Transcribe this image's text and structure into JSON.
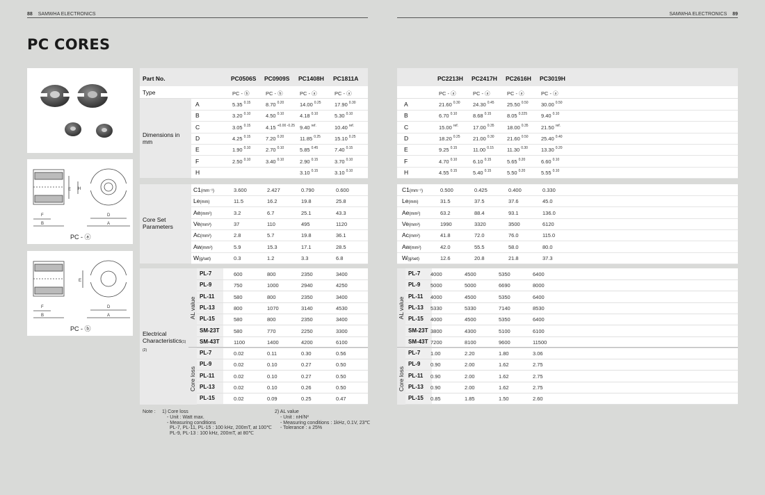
{
  "header": {
    "left_page": "88",
    "left_brand": "SAMWHA ELECTRONICS",
    "right_brand": "SAMWHA ELECTRONICS",
    "right_page": "89"
  },
  "title": "PC CORES",
  "captions": {
    "fig_a": "PC - ⓐ",
    "fig_b": "PC - ⓑ"
  },
  "diagram_labels": {
    "A": "A",
    "B": "B",
    "D": "D",
    "E": "E",
    "F": "F",
    "H": "H"
  },
  "left_table": {
    "part_label": "Part No.",
    "type_label": "Type",
    "parts": [
      "PC0506S",
      "PC0909S",
      "PC1408H",
      "PC1811A"
    ],
    "types": [
      "PC - ⓑ",
      "PC - ⓑ",
      "PC - ⓐ",
      "PC - ⓐ"
    ],
    "dim_group": "Dimensions in mm",
    "dim_rows": [
      {
        "k": "A",
        "v": [
          [
            "5.35",
            "0.15"
          ],
          [
            "8.70",
            "0.20"
          ],
          [
            "14.00",
            "0.25"
          ],
          [
            "17.90",
            "0.30"
          ]
        ]
      },
      {
        "k": "B",
        "v": [
          [
            "3.20",
            "0.10"
          ],
          [
            "4.50",
            "0.10"
          ],
          [
            "4.18",
            "0.10"
          ],
          [
            "5.30",
            "0.10"
          ]
        ]
      },
      {
        "k": "C",
        "v": [
          [
            "3.05",
            "0.15"
          ],
          [
            "4.15",
            "+0.00 -0.25"
          ],
          [
            "9.40",
            "ref."
          ],
          [
            "10.40",
            "ref."
          ]
        ]
      },
      {
        "k": "D",
        "v": [
          [
            "4.25",
            "0.15"
          ],
          [
            "7.20",
            "0.20"
          ],
          [
            "11.85",
            "0.25"
          ],
          [
            "15.10",
            "0.25"
          ]
        ]
      },
      {
        "k": "E",
        "v": [
          [
            "1.90",
            "0.10"
          ],
          [
            "2.70",
            "0.10"
          ],
          [
            "5.85",
            "0.45"
          ],
          [
            "7.40",
            "0.15"
          ]
        ]
      },
      {
        "k": "F",
        "v": [
          [
            "2.50",
            "0.10"
          ],
          [
            "3.40",
            "0.10"
          ],
          [
            "2.90",
            "0.15"
          ],
          [
            "3.70",
            "0.10"
          ]
        ]
      },
      {
        "k": "H",
        "v": [
          [
            "",
            ""
          ],
          [
            "",
            ""
          ],
          [
            "3.10",
            "0.15"
          ],
          [
            "3.10",
            "0.10"
          ]
        ]
      }
    ],
    "core_group": "Core Set Parameters",
    "core_rows": [
      {
        "k": "C1",
        "u": "(mm⁻¹)",
        "v": [
          "3.600",
          "2.427",
          "0.790",
          "0.600"
        ]
      },
      {
        "k": "Le",
        "u": "(mm)",
        "v": [
          "11.5",
          "16.2",
          "19.8",
          "25.8"
        ]
      },
      {
        "k": "Ae",
        "u": "(mm²)",
        "v": [
          "3.2",
          "6.7",
          "25.1",
          "43.3"
        ]
      },
      {
        "k": "Ve",
        "u": "(mm³)",
        "v": [
          "37",
          "110",
          "495",
          "1120"
        ]
      },
      {
        "k": "Ac",
        "u": "(mm²)",
        "v": [
          "2.8",
          "5.7",
          "19.8",
          "36.1"
        ]
      },
      {
        "k": "Aw",
        "u": "(mm²)",
        "v": [
          "5.9",
          "15.3",
          "17.1",
          "28.5"
        ]
      },
      {
        "k": "W",
        "u": "(g/set)",
        "v": [
          "0.3",
          "1.2",
          "3.3",
          "6.8"
        ]
      }
    ],
    "elec_group": "Electrical Characteristics",
    "elec_note": "(1)(2)",
    "al_label": "AL value",
    "al_rows": [
      {
        "k": "PL-7",
        "v": [
          "600",
          "800",
          "2350",
          "3400"
        ]
      },
      {
        "k": "PL-9",
        "v": [
          "750",
          "1000",
          "2940",
          "4250"
        ]
      },
      {
        "k": "PL-11",
        "v": [
          "580",
          "800",
          "2350",
          "3400"
        ]
      },
      {
        "k": "PL-13",
        "v": [
          "800",
          "1070",
          "3140",
          "4530"
        ]
      },
      {
        "k": "PL-15",
        "v": [
          "580",
          "800",
          "2350",
          "3400"
        ]
      },
      {
        "k": "SM-23T",
        "v": [
          "580",
          "770",
          "2250",
          "3300"
        ]
      },
      {
        "k": "SM-43T",
        "v": [
          "1100",
          "1400",
          "4200",
          "6100"
        ]
      }
    ],
    "loss_label": "Core loss",
    "loss_rows": [
      {
        "k": "PL-7",
        "v": [
          "0.02",
          "0.11",
          "0.30",
          "0.56"
        ]
      },
      {
        "k": "PL-9",
        "v": [
          "0.02",
          "0.10",
          "0.27",
          "0.50"
        ]
      },
      {
        "k": "PL-11",
        "v": [
          "0.02",
          "0.10",
          "0.27",
          "0.50"
        ]
      },
      {
        "k": "PL-13",
        "v": [
          "0.02",
          "0.10",
          "0.26",
          "0.50"
        ]
      },
      {
        "k": "PL-15",
        "v": [
          "0.02",
          "0.09",
          "0.25",
          "0.47"
        ]
      }
    ]
  },
  "right_table": {
    "parts": [
      "PC2213H",
      "PC2417H",
      "PC2616H",
      "PC3019H"
    ],
    "types": [
      "PC - ⓐ",
      "PC - ⓐ",
      "PC - ⓐ",
      "PC - ⓐ"
    ],
    "dim_rows": [
      {
        "k": "A",
        "v": [
          [
            "21.60",
            "0.30"
          ],
          [
            "24.30",
            "0.45"
          ],
          [
            "25.50",
            "0.50"
          ],
          [
            "30.00",
            "0.50"
          ]
        ]
      },
      {
        "k": "B",
        "v": [
          [
            "6.70",
            "0.10"
          ],
          [
            "8.68",
            "0.15"
          ],
          [
            "8.05",
            "0.225"
          ],
          [
            "9.40",
            "0.10"
          ]
        ]
      },
      {
        "k": "C",
        "v": [
          [
            "15.00",
            "ref."
          ],
          [
            "17.00",
            "0.35"
          ],
          [
            "18.00",
            "0.35"
          ],
          [
            "21.50",
            "ref."
          ]
        ]
      },
      {
        "k": "D",
        "v": [
          [
            "18.20",
            "0.25"
          ],
          [
            "21.00",
            "0.30"
          ],
          [
            "21.60",
            "0.50"
          ],
          [
            "25.40",
            "0.40"
          ]
        ]
      },
      {
        "k": "E",
        "v": [
          [
            "9.25",
            "0.15"
          ],
          [
            "11.00",
            "0.15"
          ],
          [
            "11.30",
            "0.30"
          ],
          [
            "13.30",
            "0.20"
          ]
        ]
      },
      {
        "k": "F",
        "v": [
          [
            "4.70",
            "0.10"
          ],
          [
            "6.10",
            "0.15"
          ],
          [
            "5.65",
            "0.20"
          ],
          [
            "6.60",
            "0.10"
          ]
        ]
      },
      {
        "k": "H",
        "v": [
          [
            "4.55",
            "0.15"
          ],
          [
            "5.40",
            "0.15"
          ],
          [
            "5.50",
            "0.20"
          ],
          [
            "5.55",
            "0.10"
          ]
        ]
      }
    ],
    "core_rows": [
      {
        "k": "C1",
        "u": "(mm⁻¹)",
        "v": [
          "0.500",
          "0.425",
          "0.400",
          "0.330"
        ]
      },
      {
        "k": "Le",
        "u": "(mm)",
        "v": [
          "31.5",
          "37.5",
          "37.6",
          "45.0"
        ]
      },
      {
        "k": "Ae",
        "u": "(mm²)",
        "v": [
          "63.2",
          "88.4",
          "93.1",
          "136.0"
        ]
      },
      {
        "k": "Ve",
        "u": "(mm³)",
        "v": [
          "1990",
          "3320",
          "3500",
          "6120"
        ]
      },
      {
        "k": "Ac",
        "u": "(mm²)",
        "v": [
          "41.8",
          "72.0",
          "76.0",
          "115.0"
        ]
      },
      {
        "k": "Aw",
        "u": "(mm²)",
        "v": [
          "42.0",
          "55.5",
          "58.0",
          "80.0"
        ]
      },
      {
        "k": "W",
        "u": "(g/set)",
        "v": [
          "12.6",
          "20.8",
          "21.8",
          "37.3"
        ]
      }
    ],
    "al_label": "AL value",
    "al_rows": [
      {
        "k": "PL-7",
        "v": [
          "4000",
          "4500",
          "5350",
          "6400"
        ]
      },
      {
        "k": "PL-9",
        "v": [
          "5000",
          "5000",
          "6690",
          "8000"
        ]
      },
      {
        "k": "PL-11",
        "v": [
          "4000",
          "4500",
          "5350",
          "6400"
        ]
      },
      {
        "k": "PL-13",
        "v": [
          "5330",
          "5330",
          "7140",
          "8530"
        ]
      },
      {
        "k": "PL-15",
        "v": [
          "4000",
          "4500",
          "5350",
          "6400"
        ]
      },
      {
        "k": "SM-23T",
        "v": [
          "3800",
          "4300",
          "5100",
          "6100"
        ]
      },
      {
        "k": "SM-43T",
        "v": [
          "7200",
          "8100",
          "9600",
          "11500"
        ]
      }
    ],
    "loss_label": "Core loss",
    "loss_rows": [
      {
        "k": "PL-7",
        "v": [
          "1.00",
          "2.20",
          "1.80",
          "3.06"
        ]
      },
      {
        "k": "PL-9",
        "v": [
          "0.90",
          "2.00",
          "1.62",
          "2.75"
        ]
      },
      {
        "k": "PL-11",
        "v": [
          "0.90",
          "2.00",
          "1.62",
          "2.75"
        ]
      },
      {
        "k": "PL-13",
        "v": [
          "0.90",
          "2.00",
          "1.62",
          "2.75"
        ]
      },
      {
        "k": "PL-15",
        "v": [
          "0.85",
          "1.85",
          "1.50",
          "2.60"
        ]
      }
    ]
  },
  "notes": {
    "note_label": "Note :",
    "n1_title": "1) Core loss",
    "n1_lines": [
      "- Unit : Watt max.",
      "- Measuring conditions",
      "PL-7, PL-11, PL-15      : 100 kHz, 200mT, at 100℃",
      "PL-9, PL-13               : 100 kHz, 200mT, at 80℃"
    ],
    "n2_title": "2) AL value",
    "n2_lines": [
      "- Unit : nH/N²",
      "- Measuring conditions : 1kHz, 0.1V, 23℃",
      "- Tolerance : ± 25%"
    ]
  }
}
